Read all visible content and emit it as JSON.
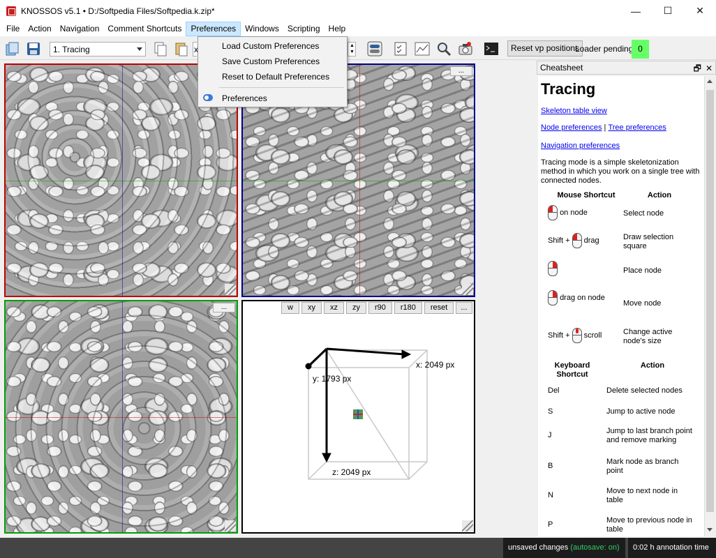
{
  "window": {
    "title": "KNOSSOS v5.1 • D:/Softpedia Files/Softpedia.k.zip*",
    "minimize": "—",
    "maximize": "☐",
    "close": "✕"
  },
  "menubar": {
    "items": [
      "File",
      "Action",
      "Navigation",
      "Comment Shortcuts",
      "Preferences",
      "Windows",
      "Scripting",
      "Help"
    ]
  },
  "toolbar": {
    "mode_select": "1. Tracing",
    "combo_partial": "x",
    "reset_vp_button": "Reset vp positions",
    "loader_label": "Loader pending:",
    "loader_count": "0"
  },
  "preferences_menu": {
    "items": [
      "Load Custom Preferences",
      "Save Custom Preferences",
      "Reset to Default Preferences",
      "Preferences"
    ]
  },
  "viewports": {
    "dots": "...",
    "vp3d_buttons": [
      "w",
      "xy",
      "xz",
      "zy",
      "r90",
      "r180",
      "reset"
    ],
    "x_label": "x: 2049 px",
    "y_label": "y: 1793 px",
    "z_label": "z: 2049 px",
    "colors": {
      "xy": "#c00000",
      "xz": "#000090",
      "zy": "#00a000",
      "vp3d": "#000000"
    }
  },
  "cheatsheet": {
    "header": "Cheatsheet",
    "float_btn": "🗗",
    "close_btn": "✕",
    "heading": "Tracing",
    "link_skeleton": "Skeleton table view",
    "link_node": "Node preferences",
    "link_sep": "|",
    "link_tree": "Tree preferences",
    "link_nav": "Navigation preferences",
    "intro": "Tracing mode is a simple skeletonization method in which you work on a single tree with connected nodes.",
    "mouse_header": {
      "shortcut": "Mouse Shortcut",
      "action": "Action"
    },
    "mouse_rows": [
      {
        "shortcut": "on node",
        "action": "Select node"
      },
      {
        "shortcut_pre": "Shift +",
        "shortcut": "drag",
        "action": "Draw selection square"
      },
      {
        "shortcut": "",
        "action": "Place node"
      },
      {
        "shortcut": "drag on node",
        "action": "Move node"
      },
      {
        "shortcut_pre": "Shift +",
        "shortcut": "scroll",
        "action": "Change active node's size"
      }
    ],
    "kb_header": {
      "shortcut": "Keyboard Shortcut",
      "action": "Action"
    },
    "kb_rows": [
      {
        "key": "Del",
        "action": "Delete selected nodes"
      },
      {
        "key": "S",
        "action": "Jump to active node"
      },
      {
        "key": "J",
        "action": "Jump to last branch point and remove marking"
      },
      {
        "key": "B",
        "action": "Mark node as branch point"
      },
      {
        "key": "N",
        "action": "Move to next node in table"
      },
      {
        "key": "P",
        "action": "Move to previous node in table"
      }
    ]
  },
  "statusbar": {
    "unsaved": "unsaved changes",
    "autosave": "(autosave: on)",
    "annotation_time": "0:02 h annotation time"
  }
}
